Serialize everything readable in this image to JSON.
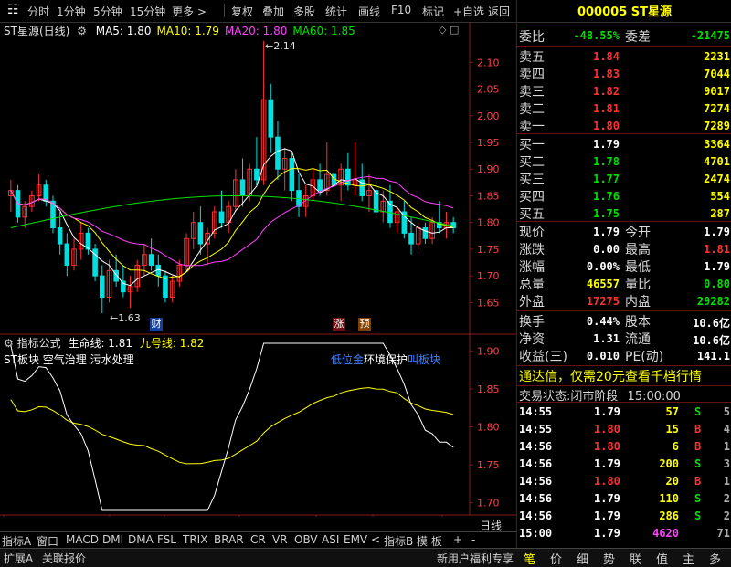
{
  "toolbar": {
    "left": [
      "分时",
      "1分钟",
      "5分钟",
      "15分钟",
      "更多 >"
    ],
    "right": [
      "复权",
      "叠加",
      "多股",
      "统计",
      "画线",
      "F10",
      "标记",
      "+自选",
      "返回"
    ]
  },
  "stock": {
    "code": "000005",
    "name": "ST星源",
    "chart_title": "ST星源(日线)"
  },
  "ma_legend": [
    {
      "label": "MA5: 1.80",
      "color": "#ffffff"
    },
    {
      "label": "MA10: 1.79",
      "color": "#ffff00"
    },
    {
      "label": "MA20: 1.80",
      "color": "#ff40ff"
    },
    {
      "label": "MA60: 1.85",
      "color": "#00e000"
    }
  ],
  "indicator": {
    "title": "指标公式",
    "line1": "生命线: 1.81",
    "line2": "九号线: 1.82",
    "tags": "ST板块 空气治理 污水处理",
    "annot": [
      "低位金",
      "环境保护",
      "叫板块"
    ]
  },
  "markers": {
    "cai": "财",
    "zhang": "涨",
    "yu": "预",
    "high": "2.14",
    "low": "1.63"
  },
  "chart_data": {
    "type": "candlestick",
    "price_axis": [
      "2.10",
      "2.05",
      "2.00",
      "1.95",
      "1.90",
      "1.85",
      "1.80",
      "1.75",
      "1.70",
      "1.65"
    ],
    "price_range": [
      1.63,
      2.14
    ],
    "indicator_axis": [
      "1.90",
      "1.85",
      "1.80",
      "1.75",
      "1.70"
    ],
    "x_labels": [
      "2022年",
      "10",
      "11",
      "12",
      "1",
      "2",
      "3"
    ],
    "period": "日线",
    "candles": [
      [
        1.85,
        1.88,
        1.82,
        1.86
      ],
      [
        1.86,
        1.87,
        1.8,
        1.81
      ],
      [
        1.81,
        1.84,
        1.79,
        1.83
      ],
      [
        1.83,
        1.86,
        1.82,
        1.85
      ],
      [
        1.85,
        1.89,
        1.84,
        1.87
      ],
      [
        1.87,
        1.88,
        1.83,
        1.84
      ],
      [
        1.84,
        1.85,
        1.78,
        1.79
      ],
      [
        1.79,
        1.82,
        1.74,
        1.76
      ],
      [
        1.76,
        1.78,
        1.7,
        1.72
      ],
      [
        1.72,
        1.77,
        1.71,
        1.75
      ],
      [
        1.75,
        1.8,
        1.73,
        1.78
      ],
      [
        1.78,
        1.79,
        1.74,
        1.75
      ],
      [
        1.75,
        1.76,
        1.69,
        1.7
      ],
      [
        1.7,
        1.72,
        1.63,
        1.66
      ],
      [
        1.66,
        1.73,
        1.65,
        1.71
      ],
      [
        1.71,
        1.74,
        1.68,
        1.69
      ],
      [
        1.69,
        1.72,
        1.66,
        1.67
      ],
      [
        1.67,
        1.7,
        1.64,
        1.68
      ],
      [
        1.68,
        1.73,
        1.67,
        1.72
      ],
      [
        1.72,
        1.76,
        1.7,
        1.74
      ],
      [
        1.74,
        1.77,
        1.71,
        1.72
      ],
      [
        1.72,
        1.74,
        1.68,
        1.7
      ],
      [
        1.7,
        1.71,
        1.65,
        1.66
      ],
      [
        1.66,
        1.7,
        1.65,
        1.69
      ],
      [
        1.69,
        1.73,
        1.68,
        1.72
      ],
      [
        1.72,
        1.78,
        1.71,
        1.77
      ],
      [
        1.77,
        1.82,
        1.75,
        1.8
      ],
      [
        1.8,
        1.83,
        1.74,
        1.76
      ],
      [
        1.76,
        1.79,
        1.72,
        1.78
      ],
      [
        1.78,
        1.83,
        1.77,
        1.82
      ],
      [
        1.82,
        1.86,
        1.79,
        1.8
      ],
      [
        1.8,
        1.84,
        1.78,
        1.83
      ],
      [
        1.83,
        1.9,
        1.82,
        1.88
      ],
      [
        1.88,
        1.92,
        1.83,
        1.85
      ],
      [
        1.85,
        1.91,
        1.84,
        1.9
      ],
      [
        1.9,
        1.96,
        1.87,
        1.88
      ],
      [
        1.88,
        2.14,
        1.87,
        2.03
      ],
      [
        2.03,
        2.06,
        1.93,
        1.96
      ],
      [
        1.96,
        1.99,
        1.88,
        1.9
      ],
      [
        1.9,
        1.94,
        1.86,
        1.92
      ],
      [
        1.92,
        1.93,
        1.84,
        1.86
      ],
      [
        1.86,
        1.89,
        1.81,
        1.83
      ],
      [
        1.83,
        1.87,
        1.81,
        1.85
      ],
      [
        1.85,
        1.9,
        1.84,
        1.88
      ],
      [
        1.88,
        1.91,
        1.85,
        1.86
      ],
      [
        1.86,
        1.95,
        1.85,
        1.89
      ],
      [
        1.89,
        1.92,
        1.86,
        1.87
      ],
      [
        1.87,
        1.91,
        1.84,
        1.9
      ],
      [
        1.9,
        1.93,
        1.86,
        1.87
      ],
      [
        1.87,
        1.95,
        1.85,
        1.88
      ],
      [
        1.88,
        1.91,
        1.84,
        1.85
      ],
      [
        1.85,
        1.89,
        1.82,
        1.86
      ],
      [
        1.86,
        1.88,
        1.81,
        1.82
      ],
      [
        1.82,
        1.86,
        1.8,
        1.84
      ],
      [
        1.84,
        1.87,
        1.79,
        1.8
      ],
      [
        1.8,
        1.83,
        1.78,
        1.82
      ],
      [
        1.82,
        1.84,
        1.77,
        1.78
      ],
      [
        1.78,
        1.81,
        1.74,
        1.76
      ],
      [
        1.76,
        1.8,
        1.75,
        1.79
      ],
      [
        1.79,
        1.8,
        1.76,
        1.77
      ],
      [
        1.77,
        1.81,
        1.76,
        1.8
      ],
      [
        1.8,
        1.84,
        1.78,
        1.79
      ],
      [
        1.79,
        1.82,
        1.77,
        1.8
      ],
      [
        1.8,
        1.81,
        1.78,
        1.79
      ]
    ]
  },
  "orderbook": {
    "weibi_label": "委比",
    "weibi": "-48.55%",
    "weicha_label": "委差",
    "weicha": "-21475",
    "sell": [
      {
        "label": "卖五",
        "price": "1.84",
        "vol": "2231"
      },
      {
        "label": "卖四",
        "price": "1.83",
        "vol": "7044"
      },
      {
        "label": "卖三",
        "price": "1.82",
        "vol": "9017"
      },
      {
        "label": "卖二",
        "price": "1.81",
        "vol": "7274"
      },
      {
        "label": "卖一",
        "price": "1.80",
        "vol": "7289"
      }
    ],
    "buy": [
      {
        "label": "买一",
        "price": "1.79",
        "vol": "3364",
        "color": "#ffffff"
      },
      {
        "label": "买二",
        "price": "1.78",
        "vol": "4701",
        "color": "#00e000"
      },
      {
        "label": "买三",
        "price": "1.77",
        "vol": "2474",
        "color": "#00e000"
      },
      {
        "label": "买四",
        "price": "1.76",
        "vol": "554",
        "color": "#00e000"
      },
      {
        "label": "买五",
        "price": "1.75",
        "vol": "287",
        "color": "#00e000"
      }
    ]
  },
  "quote": [
    {
      "l1": "现价",
      "v1": "1.79",
      "c1": "#ffffff",
      "l2": "今开",
      "v2": "1.79",
      "c2": "#ffffff"
    },
    {
      "l1": "涨跌",
      "v1": "0.00",
      "c1": "#ffffff",
      "l2": "最高",
      "v2": "1.81",
      "c2": "#ff3030"
    },
    {
      "l1": "涨幅",
      "v1": "0.00%",
      "c1": "#ffffff",
      "l2": "最低",
      "v2": "1.79",
      "c2": "#ffffff"
    },
    {
      "l1": "总量",
      "v1": "46557",
      "c1": "#ffff00",
      "l2": "量比",
      "v2": "0.80",
      "c2": "#00e000"
    },
    {
      "l1": "外盘",
      "v1": "17275",
      "c1": "#ff3030",
      "l2": "内盘",
      "v2": "29282",
      "c2": "#00e000"
    }
  ],
  "fundamental": [
    {
      "l1": "换手",
      "v1": "0.44%",
      "l2": "股本",
      "v2": "10.6亿"
    },
    {
      "l1": "净资",
      "v1": "1.31",
      "l2": "流通",
      "v2": "10.6亿"
    },
    {
      "l1": "收益(三)",
      "v1": "0.010",
      "l2": "PE(动)",
      "v2": "141.1"
    }
  ],
  "promo": "通达信，仅需20元查看千档行情",
  "trade_status": {
    "label": "交易状态:",
    "value": "闭市阶段",
    "time": "15:00:00"
  },
  "ticks": [
    {
      "t": "14:55",
      "p": "1.79",
      "pc": "#ffffff",
      "v": "57",
      "f": "S",
      "fc": "#00e000",
      "n": "5"
    },
    {
      "t": "14:55",
      "p": "1.80",
      "pc": "#ff3030",
      "v": "15",
      "f": "B",
      "fc": "#ff3030",
      "n": "4"
    },
    {
      "t": "14:56",
      "p": "1.80",
      "pc": "#ff3030",
      "v": "6",
      "f": "B",
      "fc": "#ff3030",
      "n": "1"
    },
    {
      "t": "14:56",
      "p": "1.79",
      "pc": "#ffffff",
      "v": "200",
      "f": "S",
      "fc": "#00e000",
      "n": "3"
    },
    {
      "t": "14:56",
      "p": "1.80",
      "pc": "#ff3030",
      "v": "20",
      "f": "B",
      "fc": "#ff3030",
      "n": "1"
    },
    {
      "t": "14:56",
      "p": "1.79",
      "pc": "#ffffff",
      "v": "110",
      "f": "S",
      "fc": "#00e000",
      "n": "2"
    },
    {
      "t": "14:56",
      "p": "1.79",
      "pc": "#ffffff",
      "v": "286",
      "f": "S",
      "fc": "#00e000",
      "n": "2"
    },
    {
      "t": "15:00",
      "p": "1.79",
      "pc": "#ffffff",
      "v": "4620",
      "f": "",
      "fc": "#ffffff",
      "n": "71"
    }
  ],
  "bottom_tabs": [
    "指标A",
    "窗口",
    "MACD",
    "DMI",
    "DMA",
    "FSL",
    "TRIX",
    "BRAR",
    "CR",
    "VR",
    "OBV",
    "ASI",
    "EMV",
    "<",
    "指标B",
    "模 板",
    "+",
    "-"
  ],
  "status_bar": {
    "left1": "扩展A",
    "left2": "关联报价",
    "right": "新用户福利专享"
  },
  "side_tabs": [
    "笔",
    "价",
    "细",
    "势",
    "联",
    "值",
    "主",
    "多"
  ]
}
